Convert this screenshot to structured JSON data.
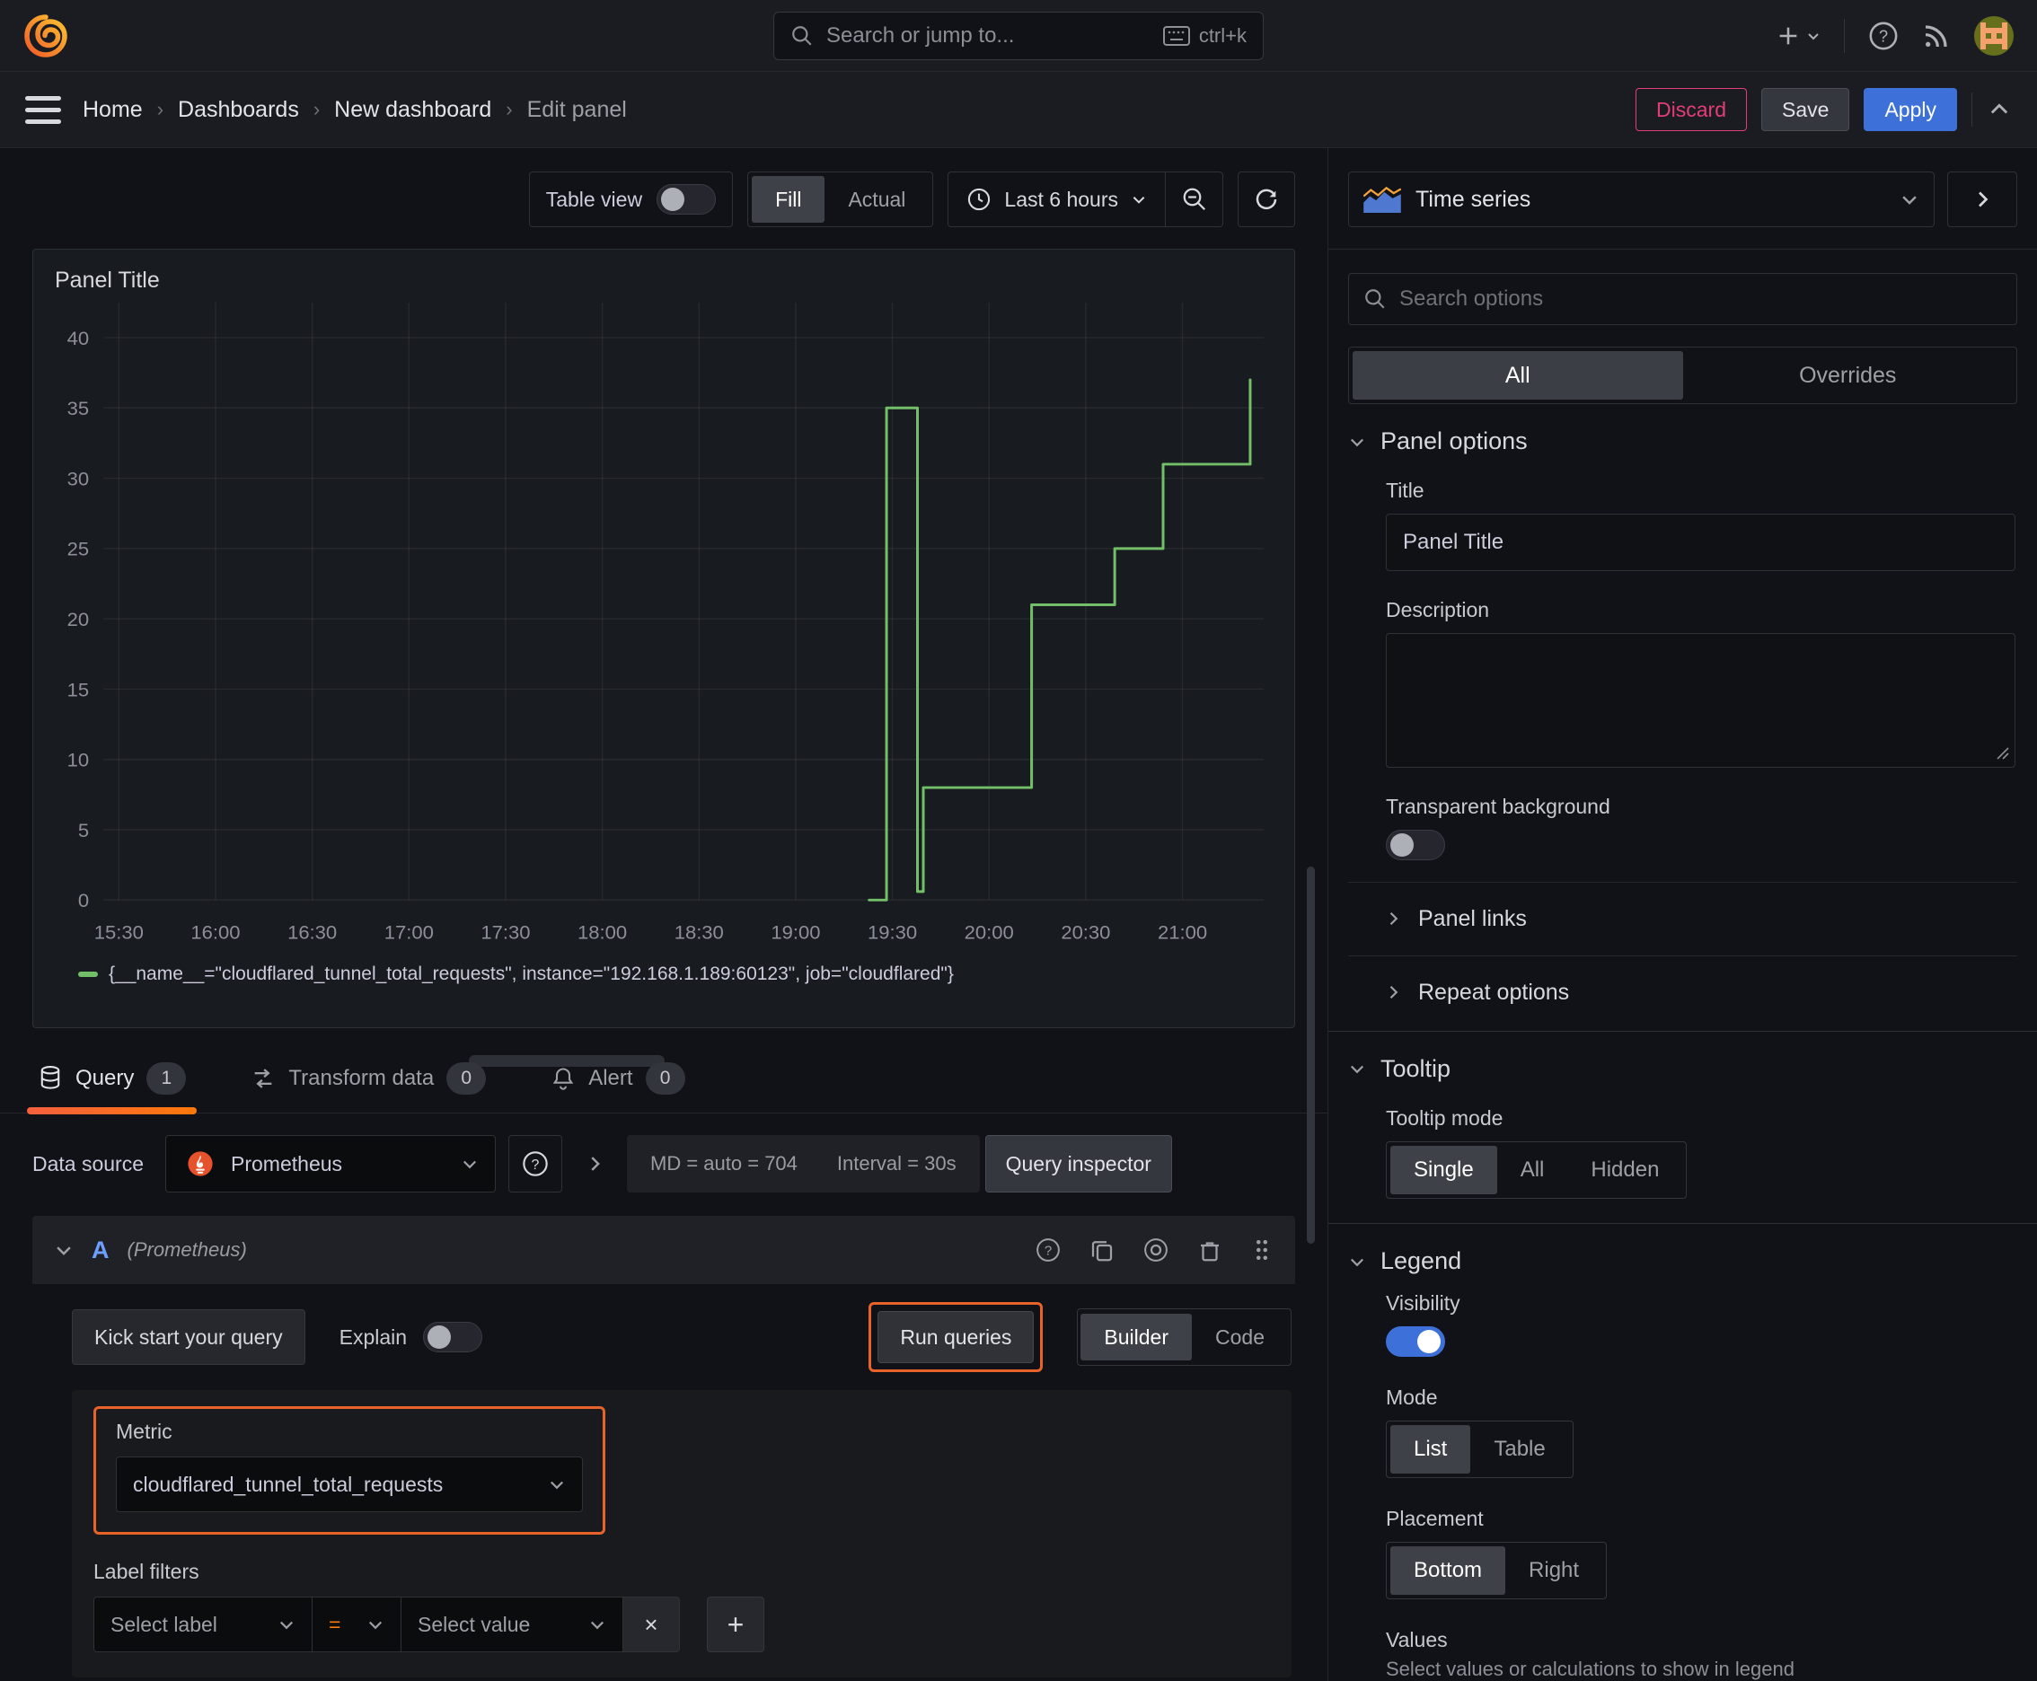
{
  "topnav": {
    "search_placeholder": "Search or jump to...",
    "search_shortcut": "ctrl+k"
  },
  "breadcrumb": {
    "items": [
      "Home",
      "Dashboards",
      "New dashboard",
      "Edit panel"
    ]
  },
  "actions": {
    "discard": "Discard",
    "save": "Save",
    "apply": "Apply"
  },
  "toolbar": {
    "table_view": "Table view",
    "fill": "Fill",
    "actual": "Actual",
    "time_range": "Last 6 hours"
  },
  "panel": {
    "title": "Panel Title"
  },
  "chart_data": {
    "type": "line",
    "title": "Panel Title",
    "xlabel": "",
    "ylabel": "",
    "x_range": [
      15.42,
      21.42
    ],
    "y_range": [
      0,
      42.5
    ],
    "grid": true,
    "legend_position": "bottom",
    "x_ticks": [
      {
        "label": "15:30",
        "value": 15.5
      },
      {
        "label": "16:00",
        "value": 16.0
      },
      {
        "label": "16:30",
        "value": 16.5
      },
      {
        "label": "17:00",
        "value": 17.0
      },
      {
        "label": "17:30",
        "value": 17.5
      },
      {
        "label": "18:00",
        "value": 18.0
      },
      {
        "label": "18:30",
        "value": 18.5
      },
      {
        "label": "19:00",
        "value": 19.0
      },
      {
        "label": "19:30",
        "value": 19.5
      },
      {
        "label": "20:00",
        "value": 20.0
      },
      {
        "label": "20:30",
        "value": 20.5
      },
      {
        "label": "21:00",
        "value": 21.0
      }
    ],
    "y_ticks": [
      0,
      5,
      10,
      15,
      20,
      25,
      30,
      35,
      40
    ],
    "series": [
      {
        "name": "{__name__=\"cloudflared_tunnel_total_requests\", instance=\"192.168.1.189:60123\", job=\"cloudflared\"}",
        "color": "#73bf69",
        "points": [
          [
            19.38,
            0
          ],
          [
            19.47,
            0
          ],
          [
            19.47,
            35
          ],
          [
            19.63,
            35
          ],
          [
            19.63,
            0.6
          ],
          [
            19.66,
            0.6
          ],
          [
            19.66,
            8
          ],
          [
            20.22,
            8
          ],
          [
            20.22,
            21
          ],
          [
            20.65,
            21
          ],
          [
            20.65,
            25
          ],
          [
            20.9,
            25
          ],
          [
            20.9,
            31
          ],
          [
            21.35,
            31
          ],
          [
            21.35,
            37
          ]
        ]
      }
    ]
  },
  "tabs": {
    "query": "Query",
    "query_count": "1",
    "transform": "Transform data",
    "transform_count": "0",
    "alert": "Alert",
    "alert_count": "0"
  },
  "datasource": {
    "label": "Data source",
    "name": "Prometheus",
    "stats_md": "MD = auto = 704",
    "stats_interval": "Interval = 30s",
    "inspector": "Query inspector"
  },
  "query_row": {
    "ref_id": "A",
    "ds_hint": "(Prometheus)"
  },
  "query_toolbar": {
    "kick_start": "Kick start your query",
    "explain": "Explain",
    "run_queries": "Run queries",
    "builder": "Builder",
    "code": "Code"
  },
  "query_editor": {
    "metric_label": "Metric",
    "metric_value": "cloudflared_tunnel_total_requests",
    "label_filters": "Label filters",
    "select_label": "Select label",
    "equals": "=",
    "select_value": "Select value"
  },
  "icons": {
    "close": "×",
    "plus": "+"
  },
  "sidebar": {
    "viz_name": "Time series",
    "search_placeholder": "Search options",
    "tab_all": "All",
    "tab_overrides": "Overrides",
    "panel_options": {
      "header": "Panel options",
      "title_label": "Title",
      "title_value": "Panel Title",
      "description_label": "Description",
      "transparent_label": "Transparent background"
    },
    "links": {
      "panel_links": "Panel links",
      "repeat_options": "Repeat options"
    },
    "tooltip": {
      "header": "Tooltip",
      "mode_label": "Tooltip mode",
      "single": "Single",
      "all": "All",
      "hidden": "Hidden"
    },
    "legend": {
      "header": "Legend",
      "visibility_label": "Visibility",
      "mode_label": "Mode",
      "list": "List",
      "table": "Table",
      "placement_label": "Placement",
      "bottom": "Bottom",
      "right": "Right",
      "values_label": "Values",
      "values_hint": "Select values or calculations to show in legend"
    }
  },
  "colors": {
    "accent_orange": "#ff780a",
    "highlight_orange": "#e8632a",
    "primary_blue": "#3d71d9",
    "series_green": "#73bf69",
    "discard_pink": "#e23d77"
  }
}
